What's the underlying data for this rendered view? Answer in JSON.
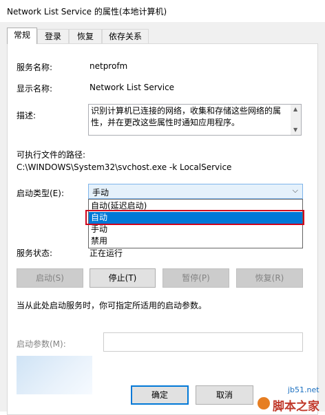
{
  "window": {
    "title": "Network List Service 的属性(本地计算机)"
  },
  "tabs": [
    {
      "label": "常规",
      "active": true
    },
    {
      "label": "登录",
      "active": false
    },
    {
      "label": "恢复",
      "active": false
    },
    {
      "label": "依存关系",
      "active": false
    }
  ],
  "general": {
    "service_name_label": "服务名称:",
    "service_name_value": "netprofm",
    "display_name_label": "显示名称:",
    "display_name_value": "Network List Service",
    "description_label": "描述:",
    "description_value": "识别计算机已连接的网络，收集和存储这些网络的属性，并在更改这些属性时通知应用程序。",
    "path_label": "可执行文件的路径:",
    "path_value": "C:\\WINDOWS\\System32\\svchost.exe -k LocalService",
    "startup_type_label": "启动类型(E):",
    "startup_type_selected": "手动",
    "startup_options": [
      "自动(延迟启动)",
      "自动",
      "手动",
      "禁用"
    ],
    "startup_option_highlighted": "自动",
    "status_label": "服务状态:",
    "status_value": "正在运行",
    "buttons": {
      "start": "启动(S)",
      "stop": "停止(T)",
      "pause": "暂停(P)",
      "resume": "恢复(R)"
    },
    "hint_text": "当从此处启动服务时，你可指定所适用的启动参数。",
    "start_params_label": "启动参数(M):",
    "start_params_value": ""
  },
  "footer": {
    "ok_label": "确定",
    "cancel_label": "取消"
  },
  "watermark": {
    "url": "jb51.net",
    "site_name": "脚本之家"
  },
  "colors": {
    "selection": "#0078d7",
    "highlight_border": "#d0021b",
    "watermark_red": "#c0392b"
  }
}
